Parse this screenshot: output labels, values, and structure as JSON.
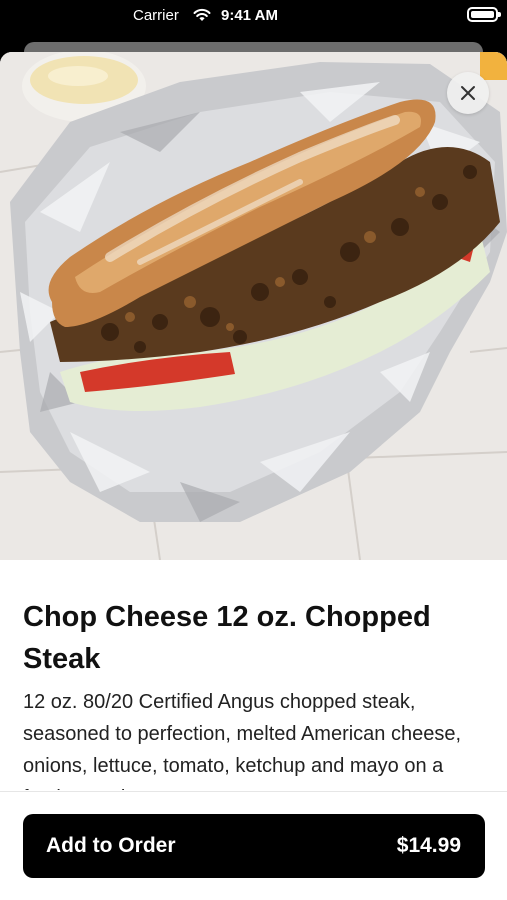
{
  "status_bar": {
    "carrier": "Carrier",
    "time": "9:41 AM",
    "wifi_icon": "wifi-icon",
    "battery_icon": "battery-icon"
  },
  "item": {
    "title": "Chop Cheese 12 oz. Chopped Steak",
    "description": "12 oz. 80/20 Certified Angus chopped steak, seasoned to perfection, melted American cheese, onions, lettuce, tomato, ketchup and mayo on a footlong sub.",
    "image": "chopped-steak-sub-photo"
  },
  "close_icon": "close-icon",
  "order_button": {
    "label": "Add to Order",
    "price": "$14.99"
  },
  "colors": {
    "button_bg": "#000000",
    "button_text": "#ffffff",
    "background": "#ffffff"
  }
}
